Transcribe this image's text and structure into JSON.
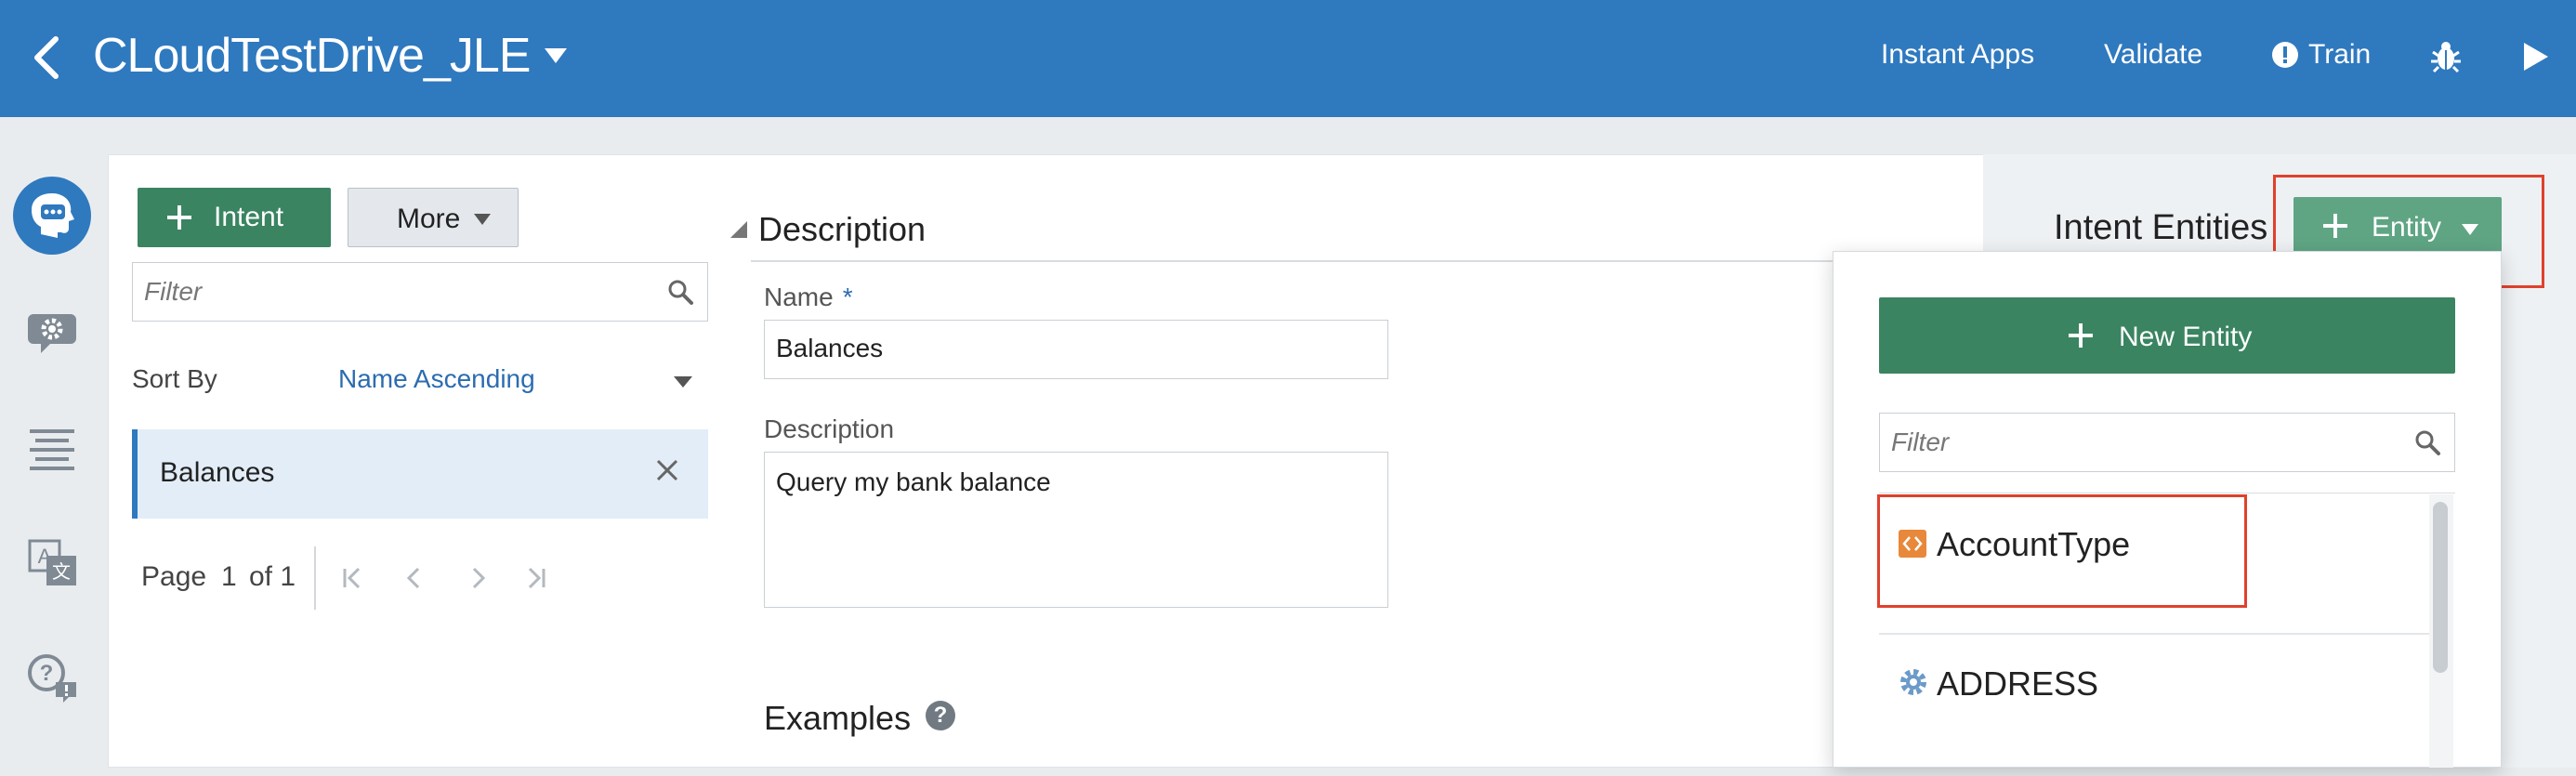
{
  "header": {
    "app_title": "CLoudTestDrive_JLE",
    "links": {
      "instant_apps": "Instant Apps",
      "validate": "Validate",
      "train": "Train"
    }
  },
  "rail": {
    "items": [
      {
        "name": "intents",
        "icon": "intent-head-icon",
        "active": true
      },
      {
        "name": "entities",
        "icon": "chat-gear-icon",
        "active": false
      },
      {
        "name": "flows",
        "icon": "text-lines-icon",
        "active": false
      },
      {
        "name": "resource-bundles",
        "icon": "translate-icon",
        "active": false
      },
      {
        "name": "faq",
        "icon": "question-bubble-icon",
        "active": false
      }
    ]
  },
  "intents_panel": {
    "add_intent_label": "Intent",
    "more_label": "More",
    "filter_placeholder": "Filter",
    "sort_by_label": "Sort By",
    "sort_value": "Name Ascending",
    "items": [
      {
        "label": "Balances",
        "selected": true
      }
    ],
    "pager": {
      "page_label": "Page",
      "current": "1",
      "of_label": "of 1"
    }
  },
  "detail": {
    "section_title": "Description",
    "name_label": "Name",
    "name_required_marker": "*",
    "name_value": "Balances",
    "description_label": "Description",
    "description_value": "Query my bank balance",
    "examples_title": "Examples",
    "help_glyph": "?"
  },
  "intent_entities": {
    "title": "Intent Entities",
    "add_entity_label": "Entity",
    "popup": {
      "new_entity_label": "New Entity",
      "filter_placeholder": "Filter",
      "entities": [
        {
          "name": "AccountType",
          "icon": "custom-entity-icon",
          "icon_color": "#e8883a"
        },
        {
          "name": "ADDRESS",
          "icon": "system-entity-gear-icon",
          "icon_color": "#6b9ac9"
        }
      ]
    }
  },
  "colors": {
    "header_blue": "#2f79bf",
    "primary_green": "#3a8461",
    "highlight_red": "#e0412c",
    "link_blue": "#2c6cb0"
  }
}
